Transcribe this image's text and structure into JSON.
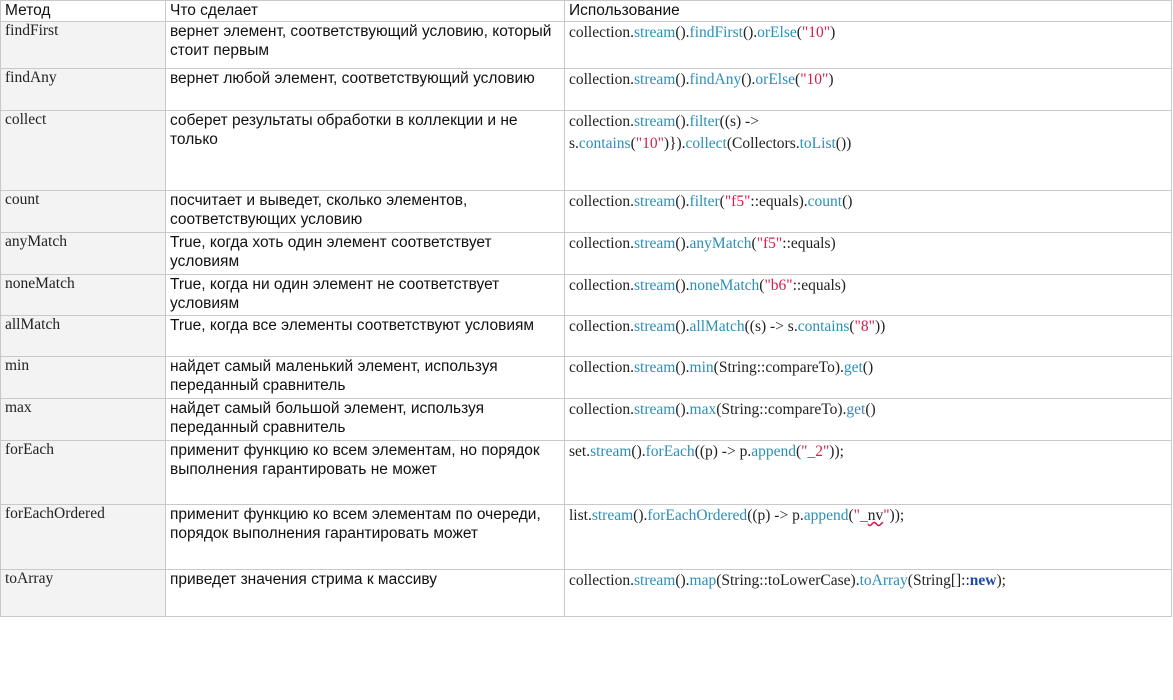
{
  "headers": {
    "method": "Метод",
    "description": "Что сделает",
    "usage": "Использование"
  },
  "colors": {
    "text": "#222222",
    "method": "#2b8fb8",
    "string": "#d81b4b",
    "keyword": "#1e4aa8",
    "method_cell_bg": "#f3f3f3"
  },
  "rows": [
    {
      "method": "findFirst",
      "description": "вернет элемент, соответствующий условию, который стоит первым",
      "usage": [
        [
          [
            "text",
            "collection."
          ],
          [
            "method",
            "stream"
          ],
          [
            "text",
            "()."
          ],
          [
            "method",
            "findFirst"
          ],
          [
            "text",
            "()."
          ],
          [
            "method",
            "orElse"
          ],
          [
            "text",
            "("
          ],
          [
            "string",
            "\"10\""
          ],
          [
            "text",
            ")"
          ]
        ]
      ]
    },
    {
      "method": "findAny",
      "description": "вернет любой элемент, соответствующий условию",
      "usage": [
        [
          [
            "text",
            "collection."
          ],
          [
            "method",
            "stream"
          ],
          [
            "text",
            "()."
          ],
          [
            "method",
            "findAny"
          ],
          [
            "text",
            "()."
          ],
          [
            "method",
            "orElse"
          ],
          [
            "text",
            "("
          ],
          [
            "string",
            "\"10\""
          ],
          [
            "text",
            ")"
          ]
        ]
      ]
    },
    {
      "method": "collect",
      "description": "соберет результаты обработки в коллекции и не только",
      "usage": [
        [
          [
            "text",
            "collection."
          ],
          [
            "method",
            "stream"
          ],
          [
            "text",
            "()."
          ],
          [
            "method",
            "filter"
          ],
          [
            "text",
            "((s) ->"
          ]
        ],
        [
          [
            "text",
            "s."
          ],
          [
            "method",
            "contains"
          ],
          [
            "text",
            "("
          ],
          [
            "string",
            "\"10\""
          ],
          [
            "text",
            ")})."
          ],
          [
            "method",
            "collect"
          ],
          [
            "text",
            "(Collectors."
          ],
          [
            "method",
            "toList"
          ],
          [
            "text",
            "())"
          ]
        ]
      ]
    },
    {
      "method": "count",
      "description": "посчитает и выведет, сколько элементов, соответствующих условию",
      "usage": [
        [
          [
            "text",
            "collection."
          ],
          [
            "method",
            "stream"
          ],
          [
            "text",
            "()."
          ],
          [
            "method",
            "filter"
          ],
          [
            "text",
            "("
          ],
          [
            "string",
            "\"f5\""
          ],
          [
            "text",
            "::equals)."
          ],
          [
            "method",
            "count"
          ],
          [
            "text",
            "()"
          ]
        ]
      ]
    },
    {
      "method": "anyMatch",
      "description": "True, когда хоть один элемент соответствует условиям",
      "usage": [
        [
          [
            "text",
            "collection."
          ],
          [
            "method",
            "stream"
          ],
          [
            "text",
            "()."
          ],
          [
            "method",
            "anyMatch"
          ],
          [
            "text",
            "("
          ],
          [
            "string",
            "\"f5\""
          ],
          [
            "text",
            "::equals)"
          ]
        ]
      ]
    },
    {
      "method": "noneMatch",
      "description": "True, когда ни один элемент не соответствует условиям",
      "usage": [
        [
          [
            "text",
            "collection."
          ],
          [
            "method",
            "stream"
          ],
          [
            "text",
            "()."
          ],
          [
            "method",
            "noneMatch"
          ],
          [
            "text",
            "("
          ],
          [
            "string",
            "\"b6\""
          ],
          [
            "text",
            "::equals)"
          ]
        ]
      ]
    },
    {
      "method": "allMatch",
      "description": "True, когда все элементы соответствуют условиям",
      "usage": [
        [
          [
            "text",
            "collection."
          ],
          [
            "method",
            "stream"
          ],
          [
            "text",
            "()."
          ],
          [
            "method",
            "allMatch"
          ],
          [
            "text",
            "((s) -> s."
          ],
          [
            "method",
            "contains"
          ],
          [
            "text",
            "("
          ],
          [
            "string",
            "\"8\""
          ],
          [
            "text",
            "))"
          ]
        ]
      ]
    },
    {
      "method": "min",
      "description": "найдет самый маленький элемент, используя переданный сравнитель",
      "usage": [
        [
          [
            "text",
            "collection."
          ],
          [
            "method",
            "stream"
          ],
          [
            "text",
            "()."
          ],
          [
            "method",
            "min"
          ],
          [
            "text",
            "(String::compareTo)."
          ],
          [
            "method",
            "get"
          ],
          [
            "text",
            "()"
          ]
        ]
      ]
    },
    {
      "method": "max",
      "description": "найдет самый большой элемент, используя переданный сравнитель",
      "usage": [
        [
          [
            "text",
            "collection."
          ],
          [
            "method",
            "stream"
          ],
          [
            "text",
            "()."
          ],
          [
            "method",
            "max"
          ],
          [
            "text",
            "(String::compareTo)."
          ],
          [
            "method",
            "get"
          ],
          [
            "text",
            "()"
          ]
        ]
      ]
    },
    {
      "method": "forEach",
      "description": "применит функцию ко всем элементам, но порядок выполнения гарантировать не может",
      "usage": [
        [
          [
            "text",
            "set."
          ],
          [
            "method",
            "stream"
          ],
          [
            "text",
            "()."
          ],
          [
            "method",
            "forEach"
          ],
          [
            "text",
            "((p) -> p."
          ],
          [
            "method",
            "append"
          ],
          [
            "text",
            "("
          ],
          [
            "string",
            "\"_2\""
          ],
          [
            "text",
            "));"
          ]
        ]
      ]
    },
    {
      "method": "forEachOrdered",
      "description": "применит функцию ко всем элементам по очереди, порядок выполнения гарантировать может",
      "usage": [
        [
          [
            "text",
            "list."
          ],
          [
            "method",
            "stream"
          ],
          [
            "text",
            "()."
          ],
          [
            "method",
            "forEachOrdered"
          ],
          [
            "text",
            "((p) -> p."
          ],
          [
            "method",
            "append"
          ],
          [
            "text",
            "("
          ],
          [
            "string",
            "\"_"
          ],
          [
            "wavy",
            "nv"
          ],
          [
            "string",
            "\""
          ],
          [
            "text",
            "));"
          ]
        ]
      ]
    },
    {
      "method": "toArray",
      "description": "приведет значения стрима к массиву",
      "usage": [
        [
          [
            "text",
            "collection."
          ],
          [
            "method",
            "stream"
          ],
          [
            "text",
            "()."
          ],
          [
            "method",
            "map"
          ],
          [
            "text",
            "(String::toLowerCase)."
          ],
          [
            "method",
            "toArray"
          ],
          [
            "text",
            "(String[]::"
          ],
          [
            "keyword",
            "new"
          ],
          [
            "text",
            ");"
          ]
        ]
      ]
    }
  ]
}
